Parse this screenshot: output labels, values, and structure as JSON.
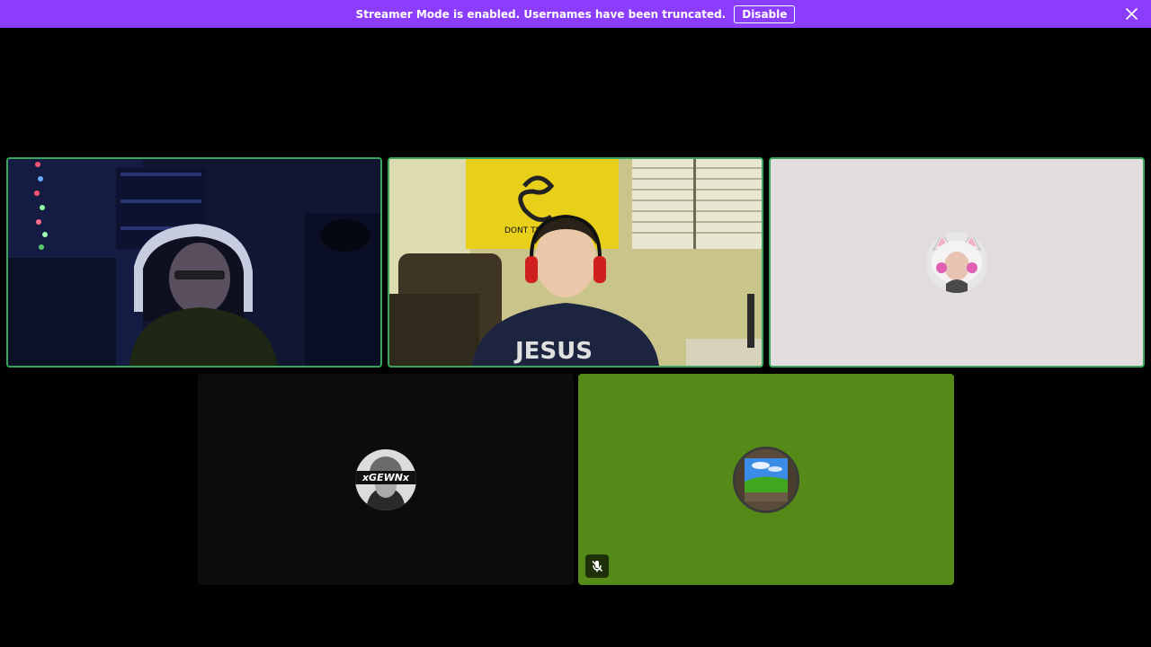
{
  "banner": {
    "message": "Streamer Mode is enabled. Usernames have been truncated.",
    "button_label": "Disable",
    "close_icon": "close-icon",
    "background_color": "#8c3dfc"
  },
  "tiles": [
    {
      "kind": "video",
      "speaking": true
    },
    {
      "kind": "video",
      "speaking": true,
      "shirt_text": "JESUS",
      "flag_text": "DONT TREAD ME"
    },
    {
      "kind": "avatar",
      "speaking": true,
      "background_color": "#e2dcdc"
    },
    {
      "kind": "avatar",
      "speaking": false,
      "avatar_text": "xGEWNx",
      "background_color": "#0c0c0c"
    },
    {
      "kind": "avatar",
      "speaking": false,
      "muted": true,
      "status_icon": "microphone-muted-icon",
      "background_color": "#558a18"
    }
  ],
  "colors": {
    "speaking_ring": "#3ba55d",
    "page_background": "#000000"
  }
}
